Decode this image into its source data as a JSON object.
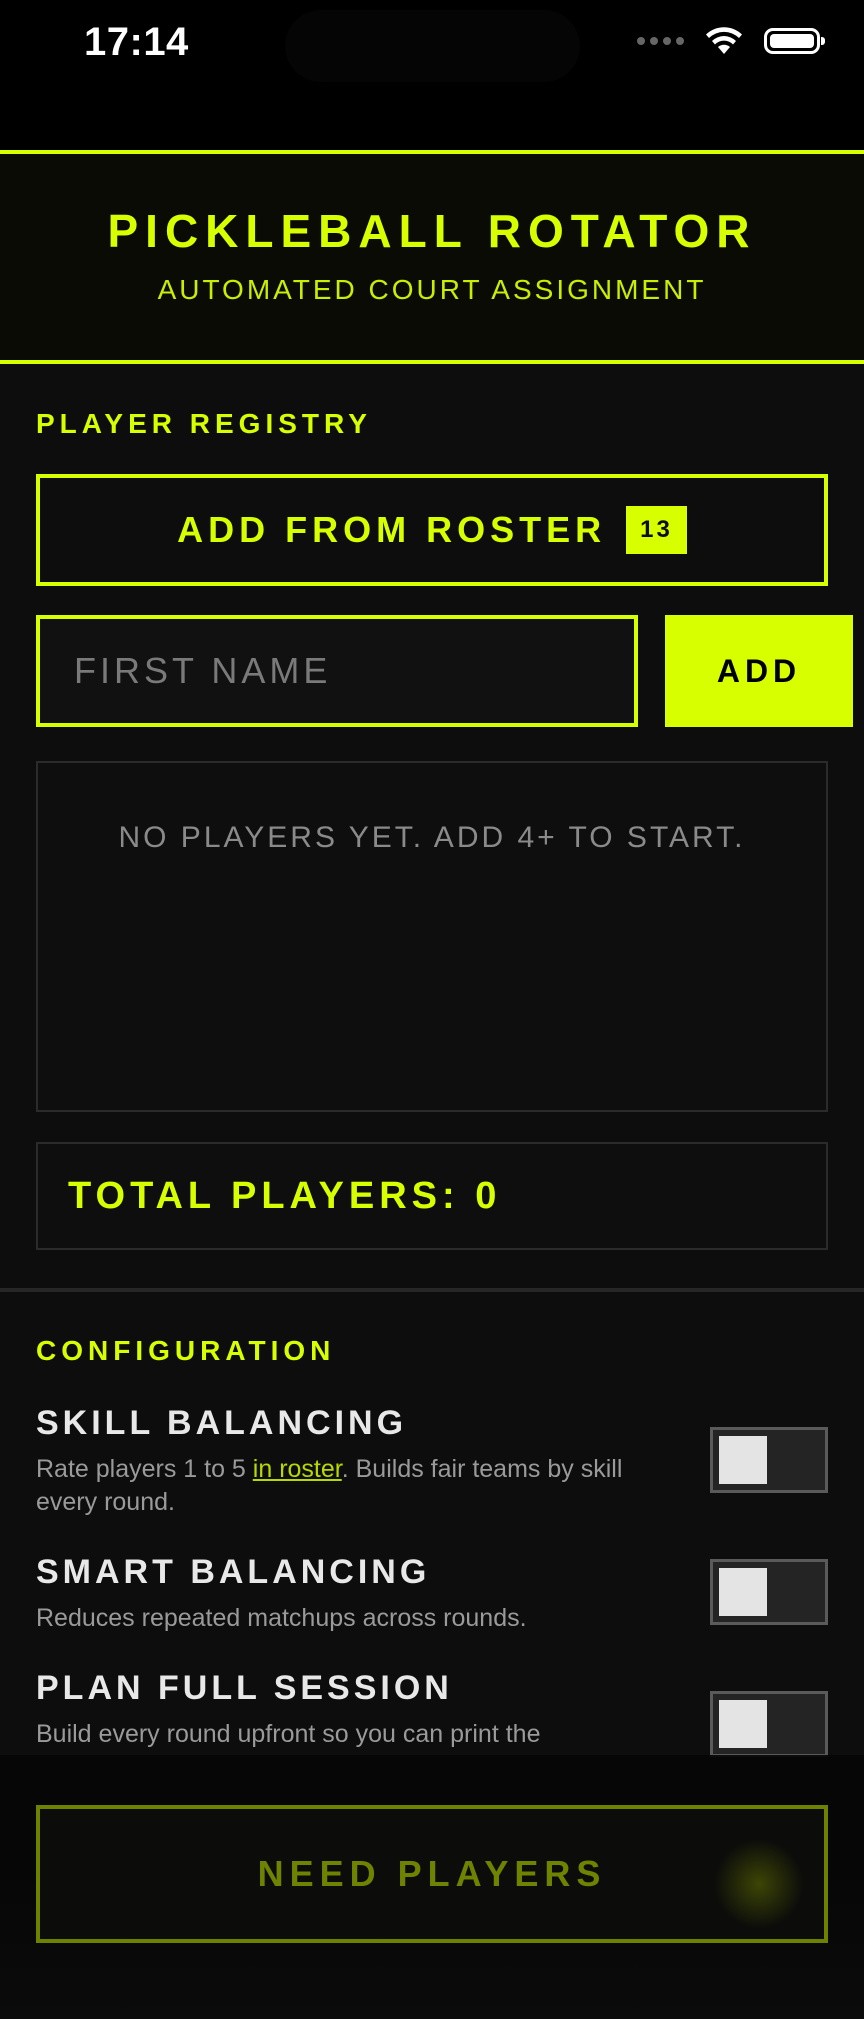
{
  "status_bar": {
    "time": "17:14"
  },
  "header": {
    "title": "PICKLEBALL ROTATOR",
    "subtitle": "AUTOMATED COURT ASSIGNMENT"
  },
  "registry": {
    "section_label": "PLAYER REGISTRY",
    "roster_button_label": "ADD FROM ROSTER",
    "roster_count": "13",
    "name_placeholder": "FIRST NAME",
    "name_value": "",
    "add_button_label": "ADD",
    "empty_message": "NO PLAYERS YET. ADD 4+ TO START.",
    "total_label": "TOTAL PLAYERS: 0"
  },
  "configuration": {
    "section_label": "CONFIGURATION",
    "settings": [
      {
        "title": "SKILL BALANCING",
        "desc_before": "Rate players 1 to 5 ",
        "desc_link": "in roster",
        "desc_after": ". Builds fair teams by skill every round.",
        "enabled": false
      },
      {
        "title": "SMART BALANCING",
        "desc": "Reduces repeated matchups across rounds.",
        "enabled": false
      },
      {
        "title": "PLAN FULL SESSION",
        "desc": "Build every round upfront so you can print the",
        "enabled": false
      }
    ]
  },
  "footer": {
    "action_label": "NEED PLAYERS"
  },
  "colors": {
    "accent": "#d8ff00",
    "background": "#0d0d0d",
    "disabled_accent": "#6e8200"
  }
}
